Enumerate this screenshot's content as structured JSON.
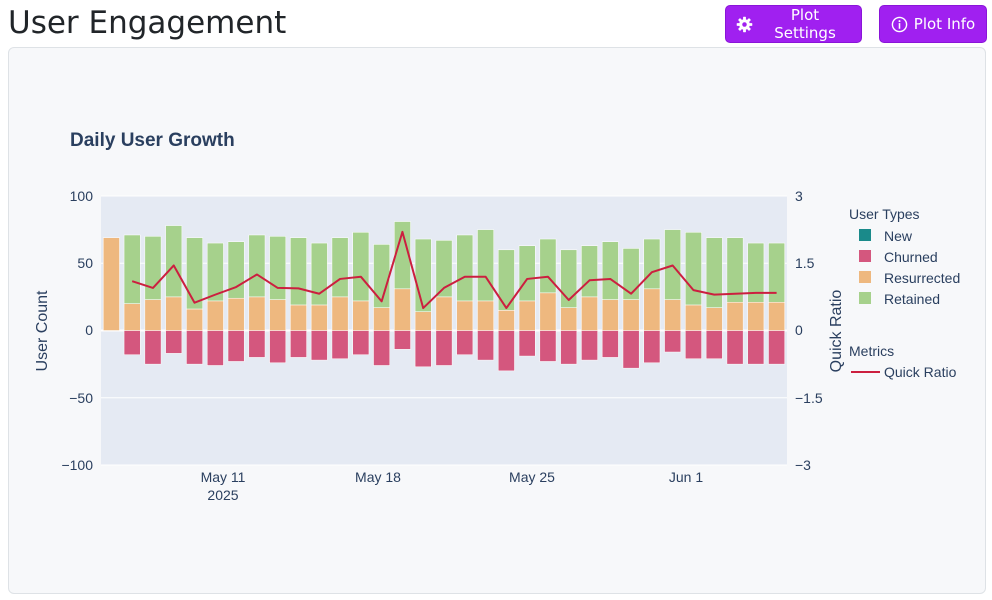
{
  "page": {
    "title": "User Engagement"
  },
  "buttons": {
    "settings": {
      "label": "Plot Settings",
      "icon": "gear-icon"
    },
    "info": {
      "label": "Plot Info",
      "icon": "info-icon"
    }
  },
  "colors": {
    "accent": "#a020f0",
    "new": "#1a8a8a",
    "churned": "#d4577e",
    "resurrected": "#eeb87f",
    "retained": "#a6d18c",
    "quick_ratio": "#cc1f3f",
    "plot_bg": "#e5eaf3"
  },
  "chart_data": {
    "type": "bar",
    "title": "Daily User Growth",
    "ylabel": "User Count",
    "y2label": "Quick Ratio",
    "ylim": [
      -100,
      100
    ],
    "y2lim": [
      -3,
      3
    ],
    "yticks": [
      "100",
      "50",
      "0",
      "−50",
      "−100"
    ],
    "y2ticks": [
      "3",
      "1.5",
      "0",
      "−1.5",
      "−3"
    ],
    "xticks": [
      "May 11",
      "May 18",
      "May 25",
      "Jun 1"
    ],
    "xtick_year": "2025",
    "x": [
      "2025-05-07",
      "2025-05-08",
      "2025-05-09",
      "2025-05-10",
      "2025-05-11",
      "2025-05-12",
      "2025-05-13",
      "2025-05-14",
      "2025-05-15",
      "2025-05-16",
      "2025-05-17",
      "2025-05-18",
      "2025-05-19",
      "2025-05-20",
      "2025-05-21",
      "2025-05-22",
      "2025-05-23",
      "2025-05-24",
      "2025-05-25",
      "2025-05-26",
      "2025-05-27",
      "2025-05-28",
      "2025-05-29",
      "2025-05-30",
      "2025-05-31",
      "2025-06-01",
      "2025-06-02",
      "2025-06-03",
      "2025-06-04",
      "2025-06-05",
      "2025-06-06",
      "2025-06-07",
      "2025-06-08"
    ],
    "barmode": "relative",
    "grid": true,
    "legend_placement": "right",
    "legend": {
      "user_types_title": "User Types",
      "metrics_title": "Metrics",
      "items": [
        "New",
        "Churned",
        "Resurrected",
        "Retained"
      ],
      "metric_items": [
        "Quick Ratio"
      ]
    },
    "series": [
      {
        "name": "New",
        "axis": "y",
        "values": [
          0,
          0,
          0,
          0,
          0,
          0,
          0,
          0,
          0,
          0,
          0,
          0,
          0,
          0,
          0,
          0,
          0,
          0,
          0,
          0,
          0,
          0,
          0,
          0,
          0,
          0,
          0,
          0,
          0,
          0,
          0,
          0,
          0
        ]
      },
      {
        "name": "Churned",
        "axis": "y",
        "values": [
          0,
          -18,
          -25,
          -17,
          -25,
          -26,
          -23,
          -20,
          -24,
          -20,
          -22,
          -21,
          -18,
          -26,
          -14,
          -27,
          -26,
          -18,
          -22,
          -30,
          -19,
          -23,
          -25,
          -22,
          -20,
          -28,
          -24,
          -16,
          -21,
          -21,
          -25,
          -25,
          -25
        ]
      },
      {
        "name": "Resurrected",
        "axis": "y",
        "values": [
          69,
          20,
          23,
          25,
          16,
          22,
          24,
          25,
          23,
          19,
          19,
          25,
          22,
          17,
          31,
          14,
          25,
          22,
          22,
          15,
          22,
          28,
          17,
          25,
          23,
          23,
          31,
          23,
          19,
          17,
          21,
          21,
          21
        ]
      },
      {
        "name": "Retained",
        "axis": "y",
        "values": [
          0,
          51,
          47,
          53,
          53,
          43,
          42,
          46,
          47,
          50,
          46,
          44,
          51,
          47,
          50,
          54,
          42,
          49,
          53,
          45,
          41,
          40,
          43,
          38,
          43,
          38,
          37,
          52,
          54,
          52,
          48,
          44,
          44
        ]
      },
      {
        "name": "Quick Ratio",
        "axis": "y2",
        "type": "line",
        "values": [
          null,
          1.1,
          0.95,
          1.45,
          0.62,
          0.8,
          0.97,
          1.25,
          0.95,
          0.94,
          0.82,
          1.15,
          1.2,
          0.65,
          2.2,
          0.5,
          0.95,
          1.2,
          1.2,
          0.5,
          1.15,
          1.2,
          0.68,
          1.12,
          1.15,
          0.82,
          1.3,
          1.45,
          0.9,
          0.8,
          0.82,
          0.84,
          0.84
        ]
      }
    ]
  }
}
